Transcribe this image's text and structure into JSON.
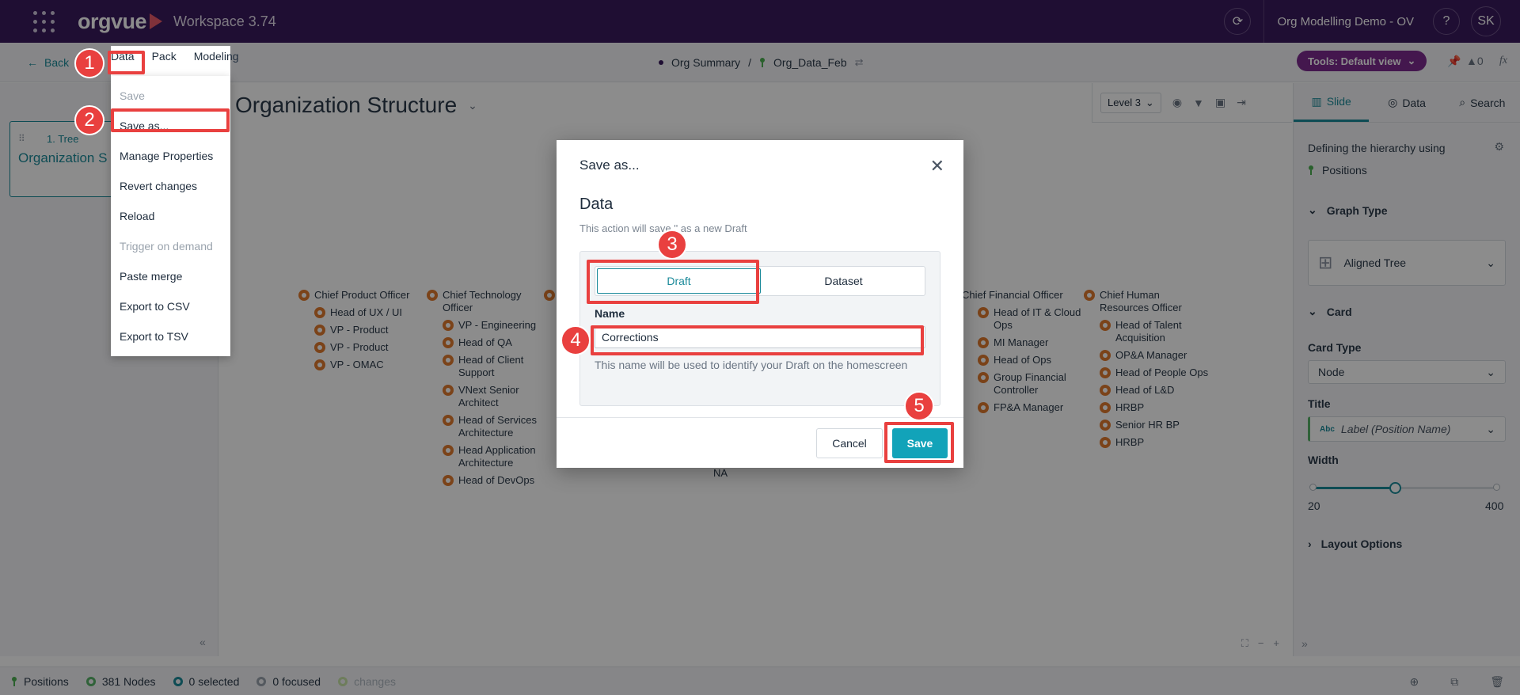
{
  "topbar": {
    "logo": "orgvue",
    "workspace": "Workspace 3.74",
    "demo": "Org Modelling Demo - OV",
    "help": "?",
    "avatar": "SK"
  },
  "subbar": {
    "back": "Back",
    "menus": [
      "Data",
      "Pack",
      "Modeling"
    ],
    "crumb_summary": "Org Summary",
    "crumb_sep": "/",
    "crumb_dataset": "Org_Data_Feb",
    "tools": "Tools: Default view",
    "alerts": "0"
  },
  "left_panel": {
    "slide_num": "1. Tree",
    "slide_title": "Organization S"
  },
  "canvas": {
    "title": "Organization Structure",
    "level": "Level 3",
    "org": [
      {
        "head": "Chief Product Officer",
        "children": [
          "Head of UX / UI",
          "VP - Product",
          "VP - Product",
          "VP - OMAC"
        ]
      },
      {
        "head": "Chief Technology Officer",
        "children": [
          "VP - Engineering",
          "Head of QA",
          "Head of Client Support",
          "VNext Senior Architect",
          "Head of Services Architecture",
          "Head Application Architecture",
          "Head of DevOps"
        ]
      },
      {
        "head": "Chief Financial Officer",
        "children": [
          "Head of IT & Cloud Ops",
          "MI Manager",
          "Head of Ops",
          "Group Financial Controller",
          "FP&A Manager"
        ]
      },
      {
        "head": "Chief Human Resources Officer",
        "children": [
          "Head of Talent Acquisition",
          "OP&A Manager",
          "Head of People Ops",
          "Head of L&D",
          "HRBP",
          "Senior HR BP",
          "HRBP"
        ]
      }
    ],
    "partial_label": "NA"
  },
  "right_panel": {
    "tabs": [
      "Slide",
      "Data",
      "Search"
    ],
    "hierarchy_label": "Defining the hierarchy using",
    "hierarchy_value": "Positions",
    "graph_type_head": "Graph Type",
    "graph_type_value": "Aligned Tree",
    "card_head": "Card",
    "card_type_label": "Card Type",
    "card_type_value": "Node",
    "title_label": "Title",
    "title_badge": "Abc",
    "title_value": "Label (Position Name)",
    "width_label": "Width",
    "width_min": "20",
    "width_max": "400",
    "width_level": 0.45,
    "layout_head": "Layout Options"
  },
  "statusbar": {
    "positions": "Positions",
    "nodes": "381 Nodes",
    "selected": "0 selected",
    "focused": "0 focused",
    "changes": "changes"
  },
  "dropdown": {
    "items": [
      {
        "label": "Save",
        "disabled": true
      },
      {
        "label": "Save as...",
        "disabled": false
      },
      {
        "label": "Manage Properties",
        "disabled": false
      },
      {
        "label": "Revert changes",
        "disabled": false
      },
      {
        "label": "Reload",
        "disabled": false
      },
      {
        "label": "Trigger on demand",
        "disabled": true
      },
      {
        "label": "Paste merge",
        "disabled": false
      },
      {
        "label": "Export to CSV",
        "disabled": false
      },
      {
        "label": "Export to TSV",
        "disabled": false
      }
    ]
  },
  "modal": {
    "title": "Save as...",
    "heading": "Data",
    "description": "This action will save '' as a new Draft",
    "tab_draft": "Draft",
    "tab_dataset": "Dataset",
    "name_label": "Name",
    "name_value": "Corrections",
    "name_help": "This name will be used to identify your Draft on the homescreen",
    "cancel": "Cancel",
    "save": "Save"
  },
  "steps": [
    "1",
    "2",
    "3",
    "4",
    "5"
  ],
  "colors": {
    "topbar": "#3a1a5e",
    "accent": "#1b8a9a",
    "save_button": "#12a3b9",
    "annotation": "#e9403f",
    "tools_pill": "#7c2b8f"
  }
}
